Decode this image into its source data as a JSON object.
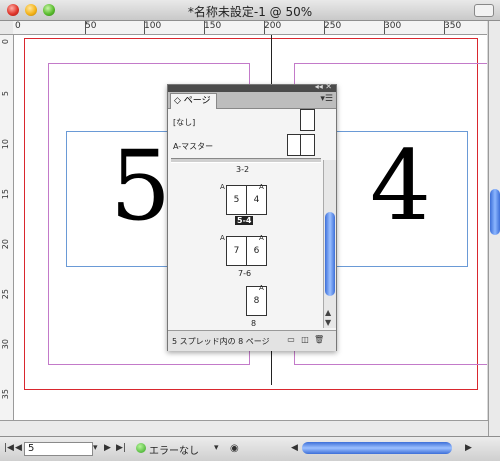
{
  "window": {
    "title": "*名称未設定-1 @ 50%"
  },
  "ruler": {
    "h_labels": [
      "0",
      "50",
      "100",
      "150",
      "200",
      "250",
      "300",
      "350"
    ],
    "v_labels": [
      "0",
      "5",
      "10",
      "15",
      "20",
      "25",
      "30",
      "35"
    ]
  },
  "spread": {
    "left_page_number": "5",
    "right_page_number": "4"
  },
  "pages_panel": {
    "tab_label": "ページ",
    "masters": [
      {
        "label": "[なし]"
      },
      {
        "label": "A-マスター"
      }
    ],
    "spreads": [
      {
        "label": "3-2",
        "pages": [
          "5",
          "4"
        ],
        "master": "A",
        "selected_label": "5-4"
      },
      {
        "label": "7-6",
        "pages": [
          "7",
          "6"
        ],
        "master": "A"
      },
      {
        "label": "8",
        "pages": [
          "8"
        ],
        "master": "A"
      }
    ],
    "footer_text": "5 スプレッド内の 8 ページ"
  },
  "statusbar": {
    "page_field": "5",
    "status_text": "エラーなし"
  }
}
